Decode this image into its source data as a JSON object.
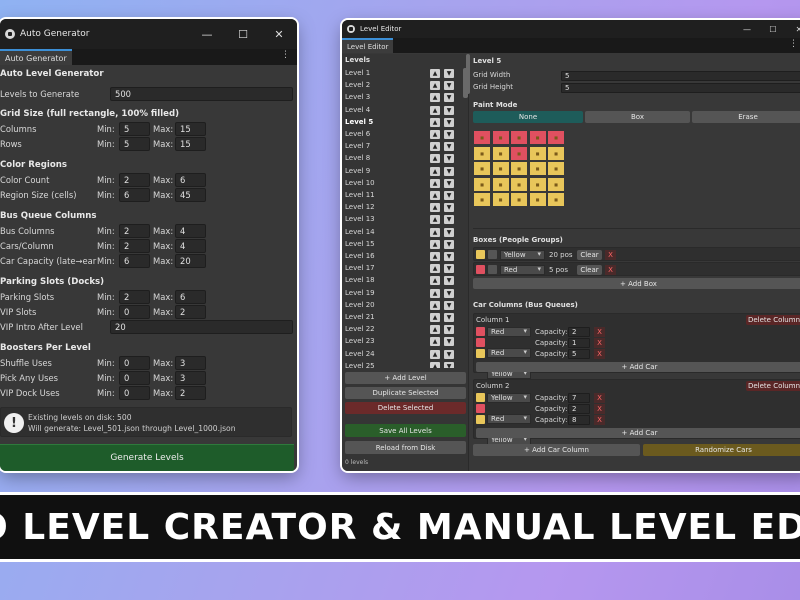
{
  "banner_text": "UTO LEVEL CREATOR & MANUAL LEVEL EDITO",
  "auto": {
    "window_title": "Auto Generator",
    "tab": "Auto Generator",
    "heading": "Auto Level Generator",
    "levels_label": "Levels to Generate",
    "levels_value": "500",
    "min_label": "Min:",
    "max_label": "Max:",
    "grid": {
      "title": "Grid Size (full rectangle, 100% filled)",
      "rows": [
        {
          "label": "Columns",
          "min": "5",
          "max": "15"
        },
        {
          "label": "Rows",
          "min": "5",
          "max": "15"
        }
      ]
    },
    "color": {
      "title": "Color Regions",
      "rows": [
        {
          "label": "Color Count",
          "min": "2",
          "max": "6"
        },
        {
          "label": "Region Size (cells)",
          "min": "6",
          "max": "45"
        }
      ]
    },
    "bus": {
      "title": "Bus Queue Columns",
      "rows": [
        {
          "label": "Bus Columns",
          "min": "2",
          "max": "4"
        },
        {
          "label": "Cars/Column",
          "min": "2",
          "max": "4"
        },
        {
          "label": "Car Capacity (late→ear",
          "min": "6",
          "max": "20"
        }
      ]
    },
    "parking": {
      "title": "Parking Slots (Docks)",
      "rows": [
        {
          "label": "Parking Slots",
          "min": "2",
          "max": "6"
        },
        {
          "label": "VIP Slots",
          "min": "0",
          "max": "2"
        }
      ],
      "vip_intro_label": "VIP Intro After Level",
      "vip_intro_value": "20"
    },
    "boosters": {
      "title": "Boosters Per Level",
      "rows": [
        {
          "label": "Shuffle Uses",
          "min": "0",
          "max": "3"
        },
        {
          "label": "Pick Any Uses",
          "min": "0",
          "max": "3"
        },
        {
          "label": "VIP Dock Uses",
          "min": "0",
          "max": "2"
        }
      ]
    },
    "info_line1": "Existing levels on disk: 500",
    "info_line2": "Will generate: Level_501.json through Level_1000.json",
    "generate_button": "Generate Levels"
  },
  "editor": {
    "window_title": "Level Editor",
    "tab": "Level Editor",
    "levels_header": "Levels",
    "levels": [
      "Level 1",
      "Level 2",
      "Level 3",
      "Level 4",
      "Level 5",
      "Level 6",
      "Level 7",
      "Level 8",
      "Level 9",
      "Level 10",
      "Level 11",
      "Level 12",
      "Level 13",
      "Level 14",
      "Level 15",
      "Level 16",
      "Level 17",
      "Level 18",
      "Level 19",
      "Level 20",
      "Level 21",
      "Level 22",
      "Level 23",
      "Level 24",
      "Level 25"
    ],
    "selected_level": "Level 5",
    "add_level": "+ Add Level",
    "duplicate_selected": "Duplicate Selected",
    "delete_selected": "Delete Selected",
    "save_all": "Save All Levels",
    "reload": "Reload from Disk",
    "footer_count": "0 levels",
    "level_title": "Level 5",
    "grid_width_label": "Grid Width",
    "grid_width": "5",
    "grid_height_label": "Grid Height",
    "grid_height": "5",
    "paint_mode_label": "Paint Mode",
    "paint_modes": [
      "None",
      "Box",
      "Erase"
    ],
    "boxes_header": "Boxes (People Groups)",
    "boxes": [
      {
        "color": "Yellow",
        "count": "20 pos",
        "clear": "Clear",
        "x": "X",
        "swatch": "#e8c65a"
      },
      {
        "color": "Red",
        "count": "5 pos",
        "clear": "Clear",
        "x": "X",
        "swatch": "#e05060"
      }
    ],
    "add_box": "+ Add Box",
    "car_columns_header": "Car Columns (Bus Queues)",
    "capacity_label": "Capacity:",
    "columns": [
      {
        "title": "Column 1",
        "delete": "Delete Column",
        "add_car": "+ Add Car",
        "cars": [
          {
            "color": "Red",
            "capacity": "2",
            "swatch": "#e05060"
          },
          {
            "color": "Red",
            "capacity": "1",
            "swatch": "#e05060"
          },
          {
            "color": "Yellow",
            "capacity": "5",
            "swatch": "#e8c65a"
          }
        ]
      },
      {
        "title": "Column 2",
        "delete": "Delete Column",
        "add_car": "+ Add Car",
        "cars": [
          {
            "color": "Yellow",
            "capacity": "7",
            "swatch": "#e8c65a"
          },
          {
            "color": "Red",
            "capacity": "2",
            "swatch": "#e05060"
          },
          {
            "color": "Yellow",
            "capacity": "8",
            "swatch": "#e8c65a"
          }
        ]
      }
    ],
    "add_car_column": "+ Add Car Column",
    "randomize_cars": "Randomize Cars",
    "paint_grid": [
      [
        "R",
        "R",
        "R",
        "R",
        "R"
      ],
      [
        "Y",
        "Y",
        "R",
        "Y",
        "Y"
      ],
      [
        "Y",
        "Y",
        "Y",
        "Y",
        "Y"
      ],
      [
        "Y",
        "Y",
        "Y",
        "Y",
        "Y"
      ],
      [
        "Y",
        "Y",
        "Y",
        "Y",
        "Y"
      ]
    ],
    "grid_colors": {
      "R": "#e05060",
      "Y": "#e8c65a"
    }
  }
}
